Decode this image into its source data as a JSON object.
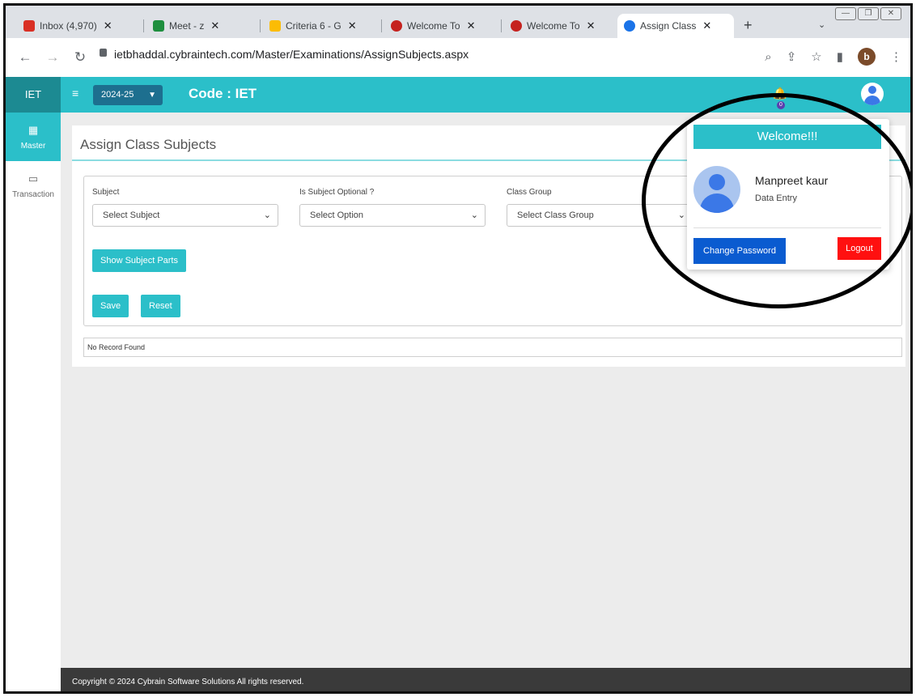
{
  "browser": {
    "tabs": [
      {
        "label": "Inbox (4,970)",
        "favicon_color": "#d93025"
      },
      {
        "label": "Meet - z",
        "favicon_color": "#1e8e3e"
      },
      {
        "label": "Criteria 6 - G",
        "favicon_color": "#fbbc04"
      },
      {
        "label": "Welcome To",
        "favicon_color": "#c5221f"
      },
      {
        "label": "Welcome To",
        "favicon_color": "#c5221f"
      },
      {
        "label": "Assign Class",
        "favicon_color": "#1a73e8",
        "active": true
      }
    ],
    "new_tab": "+",
    "url": "ietbhaddal.cybraintech.com/Master/Examinations/AssignSubjects.aspx",
    "profile_initial": "b"
  },
  "app": {
    "brand": "IET",
    "session": "2024-25",
    "code_label": "Code : IET",
    "notification_count": "0",
    "accent_color": "#2bbfc9"
  },
  "sidebar": {
    "items": [
      {
        "label": "Master",
        "active": true
      },
      {
        "label": "Transaction",
        "active": false
      }
    ]
  },
  "page": {
    "title": "Assign Class Subjects",
    "form": {
      "subject_label": "Subject",
      "subject_value": "Select Subject",
      "optional_label": "Is Subject Optional ?",
      "optional_value": "Select Option",
      "group_label": "Class Group",
      "group_value": "Select Class Group"
    },
    "buttons": {
      "show_parts": "Show Subject Parts",
      "save": "Save",
      "reset": "Reset"
    },
    "records_text": "No Record Found"
  },
  "user_menu": {
    "header": "Welcome!!!",
    "name": "Manpreet kaur",
    "role": "Data Entry",
    "change_password": "Change Password",
    "logout": "Logout"
  },
  "footer": {
    "text": "Copyright © 2024 Cybrain Software Solutions All rights reserved."
  }
}
